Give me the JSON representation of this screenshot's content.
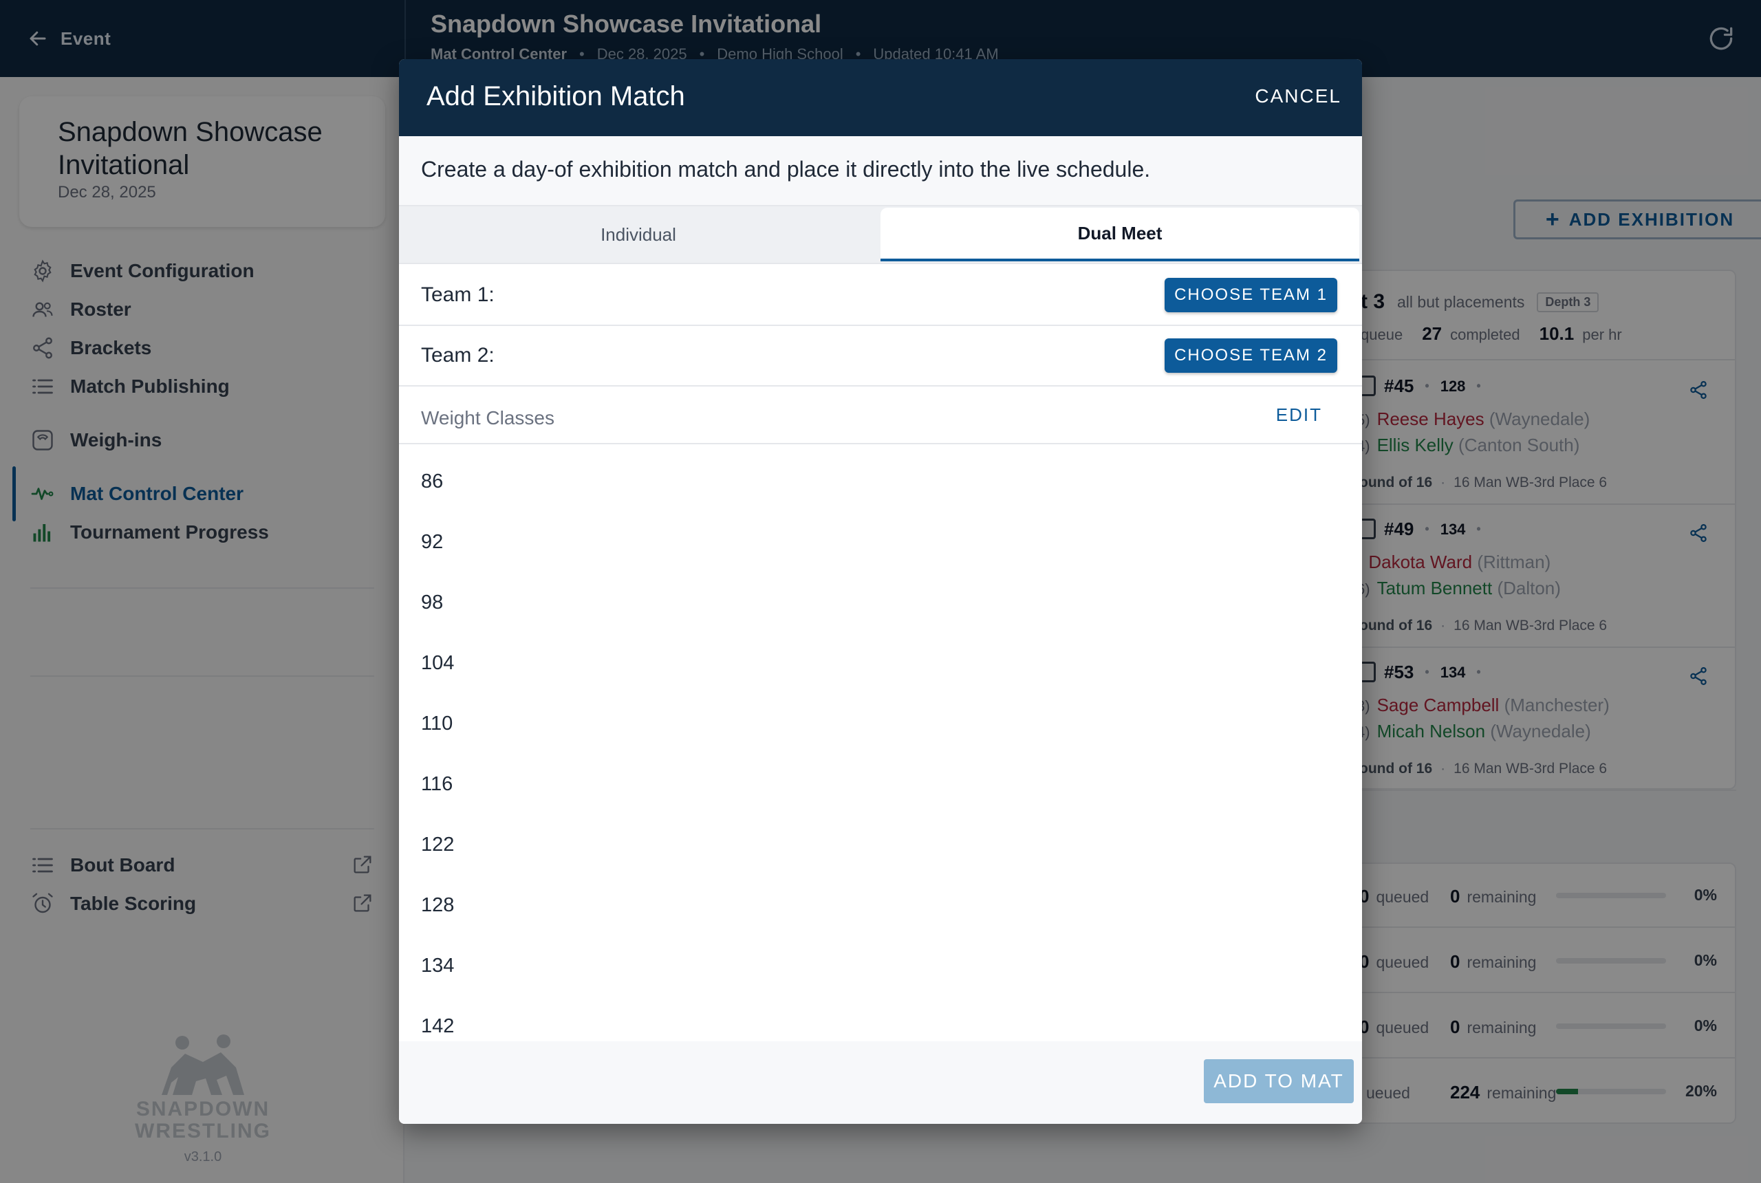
{
  "topbar": {
    "back_label": "Event",
    "title": "Snapdown Showcase Invitational",
    "meta": [
      "Mat Control Center",
      "Dec 28, 2025",
      "Demo High School",
      "Updated 10:41 AM"
    ],
    "separator": "•"
  },
  "sidebar": {
    "event_name": "Snapdown Showcase Invitational",
    "event_date": "Dec 28, 2025",
    "items": [
      {
        "label": "Event Configuration",
        "icon": "gear-icon"
      },
      {
        "label": "Roster",
        "icon": "users-icon"
      },
      {
        "label": "Brackets",
        "icon": "share-icon"
      },
      {
        "label": "Match Publishing",
        "icon": "list-icon"
      },
      {
        "label": "Weigh-ins",
        "icon": "scale-icon"
      },
      {
        "label": "Mat Control Center",
        "icon": "activity-icon"
      },
      {
        "label": "Tournament Progress",
        "icon": "bar-chart-icon"
      },
      {
        "label": "Bout Board",
        "icon": "list-icon"
      },
      {
        "label": "Table Scoring",
        "icon": "alarm-icon"
      }
    ],
    "brand_line1": "SNAPDOWN",
    "brand_line2": "WRESTLING",
    "version": "v3.1.0"
  },
  "main": {
    "add_exhibition": "ADD EXHIBITION",
    "queue": {
      "title_fragment": "t 3",
      "subtitle": "all but placements",
      "depth_badge": "Depth 3",
      "queue_fragment": "queue",
      "completed_value": "27",
      "completed_label": "completed",
      "rate_value": "10.1",
      "rate_label": "per hr"
    },
    "matches": [
      {
        "num": "#45",
        "weight": "128",
        "red_seed": "5)",
        "red_name": "Reese Hayes",
        "red_team": "(Waynedale)",
        "green_seed": "4)",
        "green_name": "Ellis Kelly",
        "green_team": "(Canton South)",
        "round": "ound of 16",
        "bracket": "16 Man WB-3rd Place 6"
      },
      {
        "num": "#49",
        "weight": "134",
        "red_seed": ")",
        "red_name": "Dakota Ward",
        "red_team": "(Rittman)",
        "green_seed": "6)",
        "green_name": "Tatum Bennett",
        "green_team": "(Dalton)",
        "round": "ound of 16",
        "bracket": "16 Man WB-3rd Place 6"
      },
      {
        "num": "#53",
        "weight": "134",
        "red_seed": "3)",
        "red_name": "Sage Campbell",
        "red_team": "(Manchester)",
        "green_seed": "4)",
        "green_name": "Micah Nelson",
        "green_team": "(Waynedale)",
        "round": "ound of 16",
        "bracket": "16 Man WB-3rd Place 6"
      }
    ],
    "mats": [
      {
        "queued": "0",
        "queued_label": "queued",
        "remaining": "0",
        "remaining_label": "remaining",
        "pct": "0%",
        "progress": 0
      },
      {
        "queued": "0",
        "queued_label": "queued",
        "remaining": "0",
        "remaining_label": "remaining",
        "pct": "0%",
        "progress": 0
      },
      {
        "queued": "0",
        "queued_label": "queued",
        "remaining": "0",
        "remaining_label": "remaining",
        "pct": "0%",
        "progress": 0
      },
      {
        "queued": "",
        "queued_label": "ueued",
        "remaining": "224",
        "remaining_label": "remaining",
        "pct": "20%",
        "progress": 0.2
      }
    ]
  },
  "dialog": {
    "title": "Add Exhibition Match",
    "cancel": "CANCEL",
    "description": "Create a day-of exhibition match and place it directly into the live schedule.",
    "tabs": [
      "Individual",
      "Dual Meet"
    ],
    "active_tab": "Dual Meet",
    "team1_label": "Team 1:",
    "team1_button": "CHOOSE TEAM 1",
    "team2_label": "Team 2:",
    "team2_button": "CHOOSE TEAM 2",
    "weight_classes_label": "Weight Classes",
    "edit": "EDIT",
    "weight_classes": [
      "86",
      "92",
      "98",
      "104",
      "110",
      "116",
      "122",
      "128",
      "134",
      "142"
    ],
    "add_to_mat": "ADD TO MAT"
  },
  "colors": {
    "header_navy": "#0f2a43",
    "accent_blue": "#0d5b9a",
    "disabled_blue": "#8eb8d6",
    "red": "#b5283e",
    "green": "#22854a"
  }
}
